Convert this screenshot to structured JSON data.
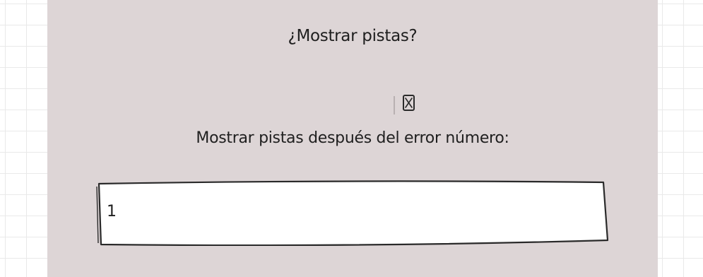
{
  "hints": {
    "question": "¿Mostrar pistas?",
    "checkbox_mark": "X",
    "field_label": "Mostrar pistas después del error número:",
    "input_value": "1"
  }
}
